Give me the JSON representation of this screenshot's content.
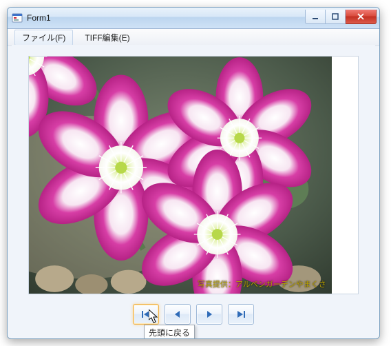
{
  "window": {
    "title": "Form1"
  },
  "menu": {
    "file": "ファイル(F)",
    "tiff_edit": "TIFF編集(E)"
  },
  "image": {
    "caption": "写真提供：アルペンガーデンやまくさ"
  },
  "nav": {
    "first_tooltip": "先頭に戻る"
  },
  "colors": {
    "nav_glyph": "#2f6bb7",
    "close_bg": "#d84b3c"
  }
}
